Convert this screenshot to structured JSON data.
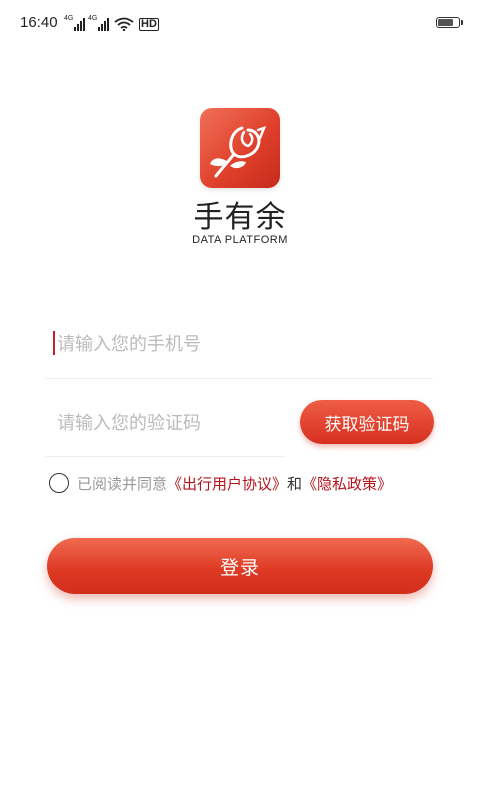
{
  "status_bar": {
    "time": "16:40",
    "sim1_label": "4G",
    "sim2_label": "4G",
    "hd_label": "HD",
    "battery_level": 0.8
  },
  "brand": {
    "name": "手有余",
    "subtitle": "DATA PLATFORM",
    "logo_colors": [
      "#f07058",
      "#c52a1a"
    ]
  },
  "form": {
    "phone_placeholder": "请输入您的手机号",
    "phone_value": "",
    "code_placeholder": "请输入您的验证码",
    "code_value": "",
    "get_code_label": "获取验证码"
  },
  "agreement": {
    "checked": false,
    "prefix": "已阅读并同意",
    "link1": "《出行用户协议》",
    "and": "和",
    "link2": "《隐私政策》"
  },
  "login_label": "登录",
  "colors": {
    "accent": "#d72f1f",
    "link": "#b5131c",
    "placeholder": "#bbbbbb"
  }
}
